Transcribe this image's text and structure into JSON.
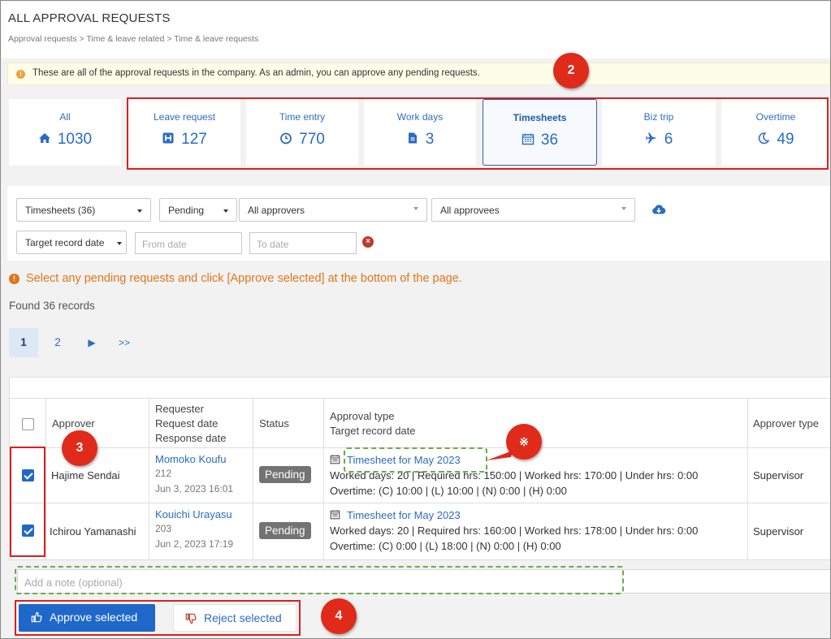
{
  "page": {
    "title": "ALL APPROVAL REQUESTS",
    "breadcrumb": "Approval requests > Time & leave related > Time & leave requests"
  },
  "notice": "These are all of the approval requests in the company. As an admin, you can approve any pending requests.",
  "tiles": [
    {
      "label": "All",
      "count": "1030",
      "icon": "home-icon"
    },
    {
      "label": "Leave request",
      "count": "127",
      "icon": "h-square-icon"
    },
    {
      "label": "Time entry",
      "count": "770",
      "icon": "clock-icon"
    },
    {
      "label": "Work days",
      "count": "3",
      "icon": "file-icon"
    },
    {
      "label": "Timesheets",
      "count": "36",
      "icon": "calendar-icon",
      "active": true
    },
    {
      "label": "Biz trip",
      "count": "6",
      "icon": "plane-icon"
    },
    {
      "label": "Overtime",
      "count": "49",
      "icon": "moon-icon"
    }
  ],
  "filters": {
    "type_select": "Timesheets (36)",
    "status_select": "Pending",
    "approvers_select": "All approvers",
    "approvees_select": "All approvees",
    "date_type_select": "Target record date",
    "from_placeholder": "From date",
    "to_placeholder": "To date"
  },
  "hint": "Select any pending requests and click [Approve selected] at the bottom of the page.",
  "found": "Found 36 records",
  "pagination": {
    "pages": [
      "1",
      "2"
    ],
    "next": "▶",
    "last": ">>"
  },
  "table": {
    "headers": {
      "approver": "Approver",
      "requester_1": "Requester",
      "requester_2": "Request date",
      "requester_3": "Response date",
      "status": "Status",
      "approval_1": "Approval type",
      "approval_2": "Target record date",
      "approver_type": "Approver type"
    },
    "rows": [
      {
        "checked": true,
        "approver": "Hajime Sendai",
        "requester": "Momoko Koufu",
        "requester_id": "212",
        "date": "Jun 3, 2023 16:01",
        "status": "Pending",
        "type_link": "Timesheet for May 2023",
        "detail_1": "Worked days: 20 | Required hrs: 150:00 | Worked hrs: 170:00 | Under hrs: 0:00",
        "detail_2": "Overtime: (C) 10:00 | (L) 10:00 | (N) 0:00 | (H) 0:00",
        "approver_type": "Supervisor"
      },
      {
        "checked": true,
        "approver": "Ichirou Yamanashi",
        "requester": "Kouichi Urayasu",
        "requester_id": "203",
        "date": "Jun 2, 2023 17:19",
        "status": "Pending",
        "type_link": "Timesheet for May 2023",
        "detail_1": "Worked days: 20 | Required hrs: 160:00 | Worked hrs: 178:00 | Under hrs: 0:00",
        "detail_2": "Overtime: (C) 0:00 | (L) 18:00 | (N) 0:00 | (H) 0:00",
        "approver_type": "Supervisor"
      }
    ]
  },
  "note_placeholder": "Add a note (optional)",
  "buttons": {
    "approve": "Approve selected",
    "reject": "Reject selected"
  },
  "callouts": {
    "c2": "2",
    "c3": "3",
    "c4": "4",
    "cx": "※"
  },
  "colors": {
    "accent": "#1f68c9",
    "link": "#2a6cc0",
    "annotation_red": "#e02a1a",
    "annotation_green": "#6aab4a",
    "hint_orange": "#e0761c"
  }
}
